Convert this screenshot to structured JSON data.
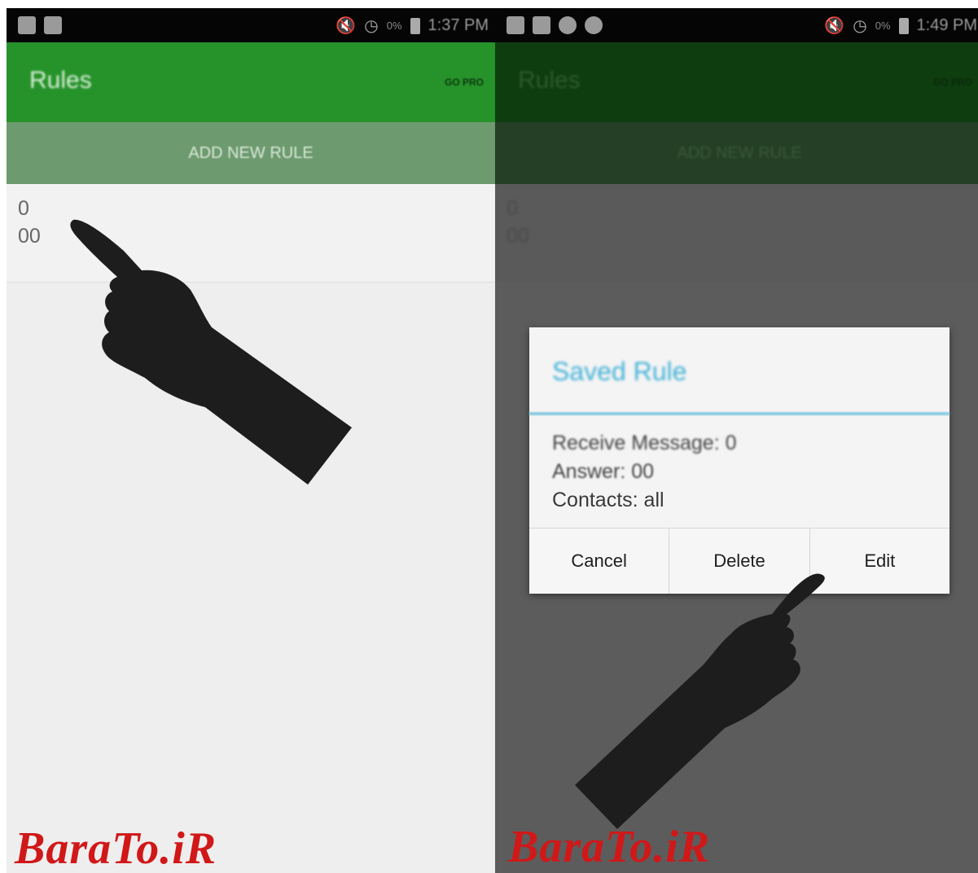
{
  "left": {
    "statusbar": {
      "time": "1:37 PM",
      "battery_pct": "0%"
    },
    "appbar": {
      "title": "Rules",
      "go_pro": "GO PRO"
    },
    "add_rule_label": "ADD NEW RULE",
    "rule": {
      "message": "0",
      "answer": "00"
    }
  },
  "right": {
    "statusbar": {
      "time": "1:49 PM",
      "battery_pct": "0%"
    },
    "appbar": {
      "title": "Rules",
      "go_pro": "GO PRO"
    },
    "add_rule_label": "ADD NEW RULE",
    "rule": {
      "message": "0",
      "answer": "00"
    },
    "dialog": {
      "title": "Saved Rule",
      "line1": "Receive Message: 0",
      "line2": "Answer: 00",
      "line3": "Contacts: all",
      "buttons": [
        "Cancel",
        "Delete",
        "Edit"
      ]
    }
  },
  "watermark": "BaraTo.iR",
  "colors": {
    "appbar_green": "#26922a",
    "dialog_title_blue": "#43b2d8",
    "watermark_red": "#d01818"
  },
  "icons": [
    "pointing-hand-icon",
    "mute-icon",
    "alarm-icon",
    "battery-icon"
  ]
}
